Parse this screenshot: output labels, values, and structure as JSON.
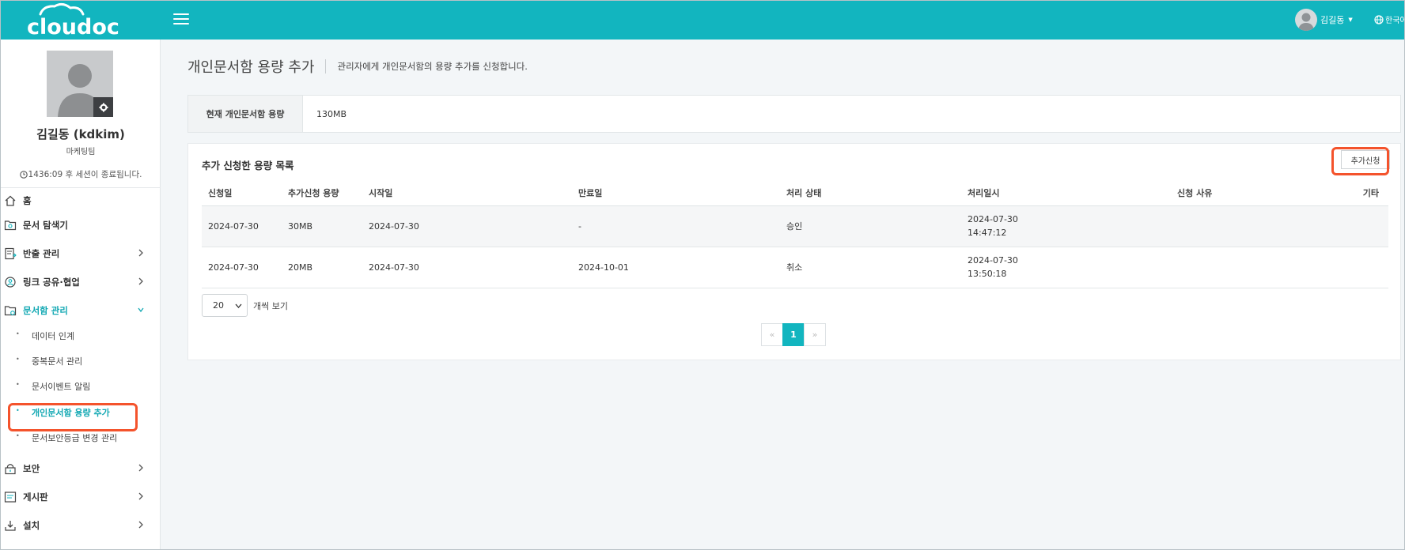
{
  "header": {
    "logo_text": "cloudoc",
    "user_name": "김길동",
    "language": "한국어"
  },
  "profile": {
    "name": "김길동 (kdkim)",
    "team": "마케팅팀",
    "session_text": "1436:09 후 세션이 종료됩니다."
  },
  "sidebar": {
    "items": [
      {
        "label": "홈",
        "icon": "home-icon"
      },
      {
        "label": "문서 탐색기",
        "icon": "explorer-icon"
      },
      {
        "label": "반출 관리",
        "icon": "export-icon"
      },
      {
        "label": "링크 공유·협업",
        "icon": "link-share-icon"
      },
      {
        "label": "문서함 관리",
        "icon": "folder-icon"
      },
      {
        "label": "보안",
        "icon": "lock-icon"
      },
      {
        "label": "게시판",
        "icon": "board-icon"
      },
      {
        "label": "설치",
        "icon": "download-icon"
      }
    ],
    "sub_items": [
      {
        "label": "데이터 인계"
      },
      {
        "label": "중복문서 관리"
      },
      {
        "label": "문서이벤트 알림"
      },
      {
        "label": "개인문서함 용량 추가"
      },
      {
        "label": "문서보안등급 변경 관리"
      }
    ]
  },
  "main": {
    "title": "개인문서함 용량 추가",
    "description": "관리자에게 개인문서함의 용량 추가를 신청합니다.",
    "capacity_label": "현재 개인문서함 용량",
    "capacity_value": "130MB",
    "list_title": "추가 신청한 용량 목록",
    "add_button": "추가신청",
    "columns": [
      "신청일",
      "추가신청 용량",
      "시작일",
      "만료일",
      "처리 상태",
      "처리일시",
      "신청 사유",
      "기타"
    ],
    "rows": [
      {
        "apply_date": "2024-07-30",
        "amount": "30MB",
        "start": "2024-07-30",
        "expire": "-",
        "status": "승인",
        "proc_date": "2024-07-30",
        "proc_time": "14:47:12",
        "reason": "",
        "etc": ""
      },
      {
        "apply_date": "2024-07-30",
        "amount": "20MB",
        "start": "2024-07-30",
        "expire": "2024-10-01",
        "status": "취소",
        "proc_date": "2024-07-30",
        "proc_time": "13:50:18",
        "reason": "",
        "etc": ""
      }
    ],
    "page_size": "20",
    "page_size_label": "개씩 보기",
    "pagination": {
      "prev": "«",
      "current": "1",
      "next": "»"
    }
  },
  "colors": {
    "brand": "#12b5bf",
    "highlight": "#f4532c"
  }
}
